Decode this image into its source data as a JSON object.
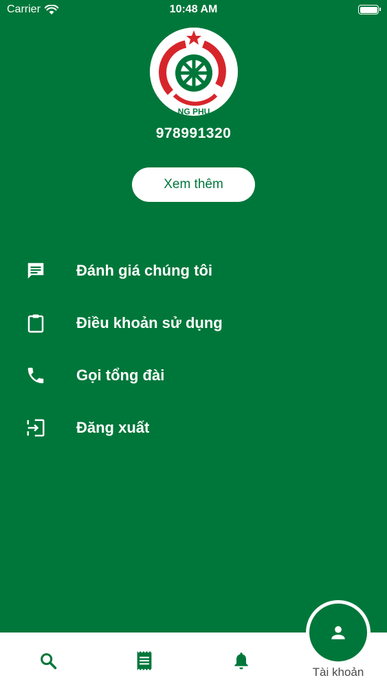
{
  "status_bar": {
    "carrier": "Carrier",
    "time": "10:48 AM"
  },
  "profile": {
    "phone": "978991320",
    "more_button": "Xem thêm",
    "logo_text": "NG PHU"
  },
  "menu": {
    "items": [
      {
        "label": "Đánh giá chúng tôi",
        "icon": "feedback-icon"
      },
      {
        "label": "Điều khoản sử dụng",
        "icon": "clipboard-icon"
      },
      {
        "label": "Gọi tổng đài",
        "icon": "phone-icon"
      },
      {
        "label": "Đăng xuất",
        "icon": "logout-icon"
      }
    ]
  },
  "bottom_nav": {
    "items": [
      {
        "icon": "search-icon"
      },
      {
        "icon": "receipt-icon"
      },
      {
        "icon": "bell-icon"
      },
      {
        "icon": "person-icon",
        "label": "Tài khoản",
        "active": true
      }
    ]
  },
  "colors": {
    "primary": "#00773a",
    "logo_red": "#d7262b"
  }
}
